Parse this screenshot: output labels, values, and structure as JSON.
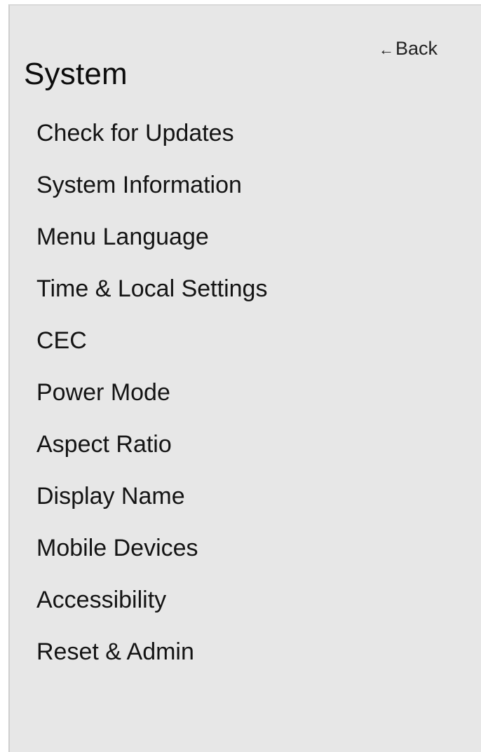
{
  "header": {
    "title": "System",
    "back_label": "Back",
    "back_arrow": "←"
  },
  "menu": {
    "items": [
      {
        "label": "Check for Updates"
      },
      {
        "label": "System Information"
      },
      {
        "label": "Menu Language"
      },
      {
        "label": "Time & Local Settings"
      },
      {
        "label": "CEC"
      },
      {
        "label": "Power Mode"
      },
      {
        "label": "Aspect Ratio"
      },
      {
        "label": "Display Name"
      },
      {
        "label": "Mobile Devices"
      },
      {
        "label": "Accessibility"
      },
      {
        "label": "Reset & Admin"
      }
    ]
  },
  "colors": {
    "panel_background": "#e7e7e7",
    "text": "#111111"
  }
}
